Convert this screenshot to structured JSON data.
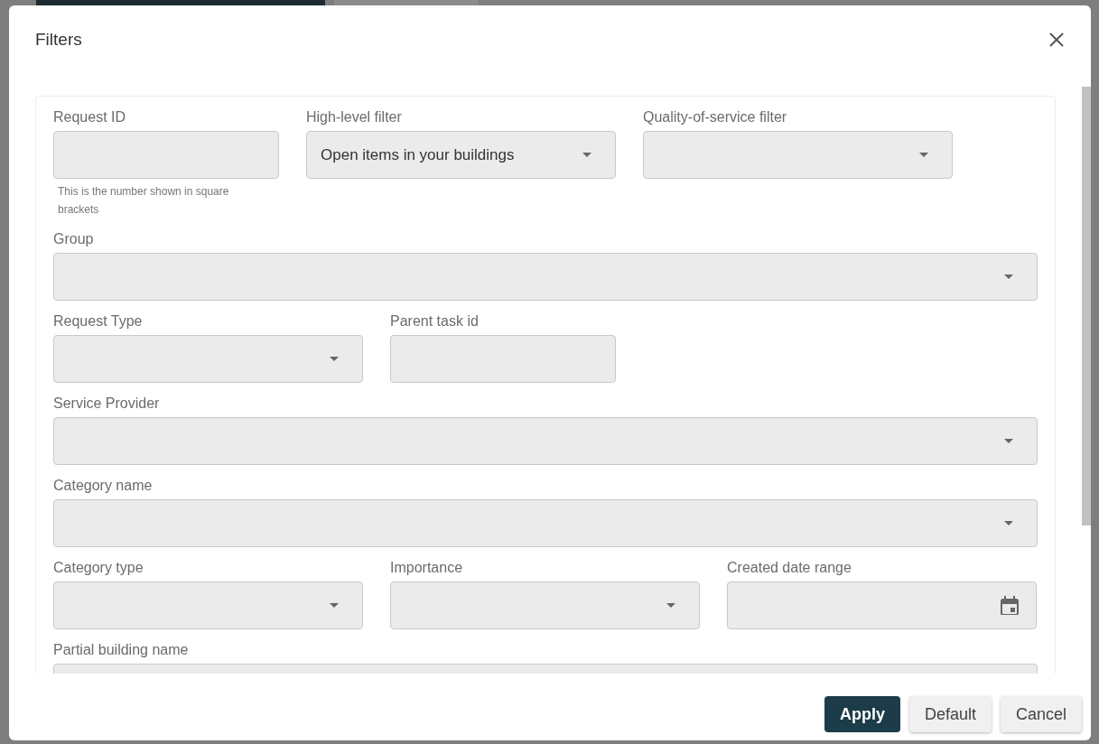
{
  "dialog": {
    "title": "Filters",
    "rows": [
      [
        {
          "label": "Request ID",
          "kind": "text",
          "hint": "This is the number shown in square brackets"
        },
        {
          "label": "High-level filter",
          "kind": "select",
          "value": "Open items in your buildings"
        },
        {
          "label": "Quality-of-service filter",
          "kind": "select"
        }
      ],
      [
        {
          "label": "Group",
          "kind": "select"
        }
      ],
      [
        {
          "label": "Request Type",
          "kind": "select"
        },
        {
          "label": "Parent task id",
          "kind": "text"
        }
      ],
      [
        {
          "label": "Service Provider",
          "kind": "select"
        }
      ],
      [
        {
          "label": "Category name",
          "kind": "select"
        }
      ],
      [
        {
          "label": "Category type",
          "kind": "select"
        },
        {
          "label": "Importance",
          "kind": "select"
        },
        {
          "label": "Created date range",
          "kind": "date"
        }
      ],
      [
        {
          "label": "Partial building name",
          "kind": "text"
        }
      ]
    ],
    "buttons": [
      {
        "label": "Apply",
        "kind": "primary"
      },
      {
        "label": "Default",
        "kind": "secondary"
      },
      {
        "label": "Cancel",
        "kind": "secondary"
      }
    ]
  }
}
